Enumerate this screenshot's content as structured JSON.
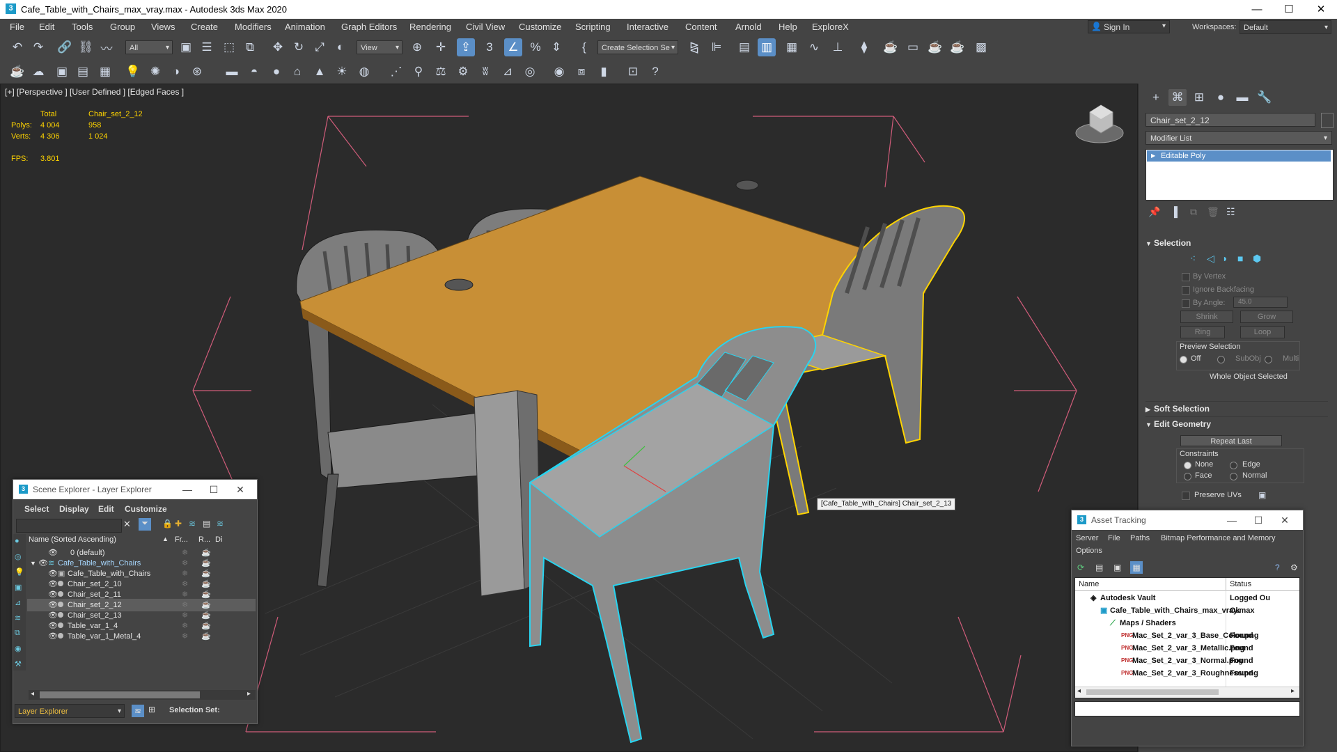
{
  "title_bar": {
    "title": "Cafe_Table_with_Chairs_max_vray.max - Autodesk 3ds Max 2020",
    "minimize": "—",
    "maximize": "☐",
    "close": "✕"
  },
  "menu": [
    "File",
    "Edit",
    "Tools",
    "Group",
    "Views",
    "Create",
    "Modifiers",
    "Animation",
    "Graph Editors",
    "Rendering",
    "Civil View",
    "Customize",
    "Scripting",
    "Interactive",
    "Content",
    "Arnold",
    "Help",
    "ExploreX"
  ],
  "account": {
    "sign_in": "Sign In",
    "workspaces_label": "Workspaces:",
    "workspace_value": "Default"
  },
  "toolbar": {
    "filter_value": "All",
    "ref_coord_value": "View",
    "selection_set_placeholder": "Create Selection Se"
  },
  "viewport": {
    "label": "[+] [Perspective ] [User Defined ] [Edged Faces ]",
    "stats": {
      "total_label": "Total",
      "object_label": "Chair_set_2_12",
      "polys_label": "Polys:",
      "polys_total": "4 004",
      "polys_obj": "958",
      "verts_label": "Verts:",
      "verts_total": "4 306",
      "verts_obj": "1 024",
      "fps_label": "FPS:",
      "fps_value": "3.801"
    },
    "tooltip": "[Cafe_Table_with_Chairs] Chair_set_2_13"
  },
  "command_panel": {
    "object_name": "Chair_set_2_12",
    "object_color": "#444444",
    "modifier_list": "Modifier List",
    "stack_item": "Editable Poly",
    "selection": {
      "title": "Selection",
      "by_vertex": "By Vertex",
      "ignore_backfacing": "Ignore Backfacing",
      "by_angle": "By Angle:",
      "angle_value": "45.0",
      "shrink": "Shrink",
      "grow": "Grow",
      "ring": "Ring",
      "loop": "Loop",
      "preview_selection": "Preview Selection",
      "off": "Off",
      "subobj": "SubObj",
      "multi": "Multi",
      "status": "Whole Object Selected"
    },
    "soft_selection": "Soft Selection",
    "edit_geometry": {
      "title": "Edit Geometry",
      "repeat_last": "Repeat Last",
      "constraints": "Constraints",
      "none": "None",
      "edge": "Edge",
      "face": "Face",
      "normal": "Normal",
      "preserve_uvs": "Preserve UVs"
    }
  },
  "scene_explorer": {
    "title": "Scene Explorer - Layer Explorer",
    "menu": [
      "Select",
      "Display",
      "Edit",
      "Customize"
    ],
    "columns": {
      "name": "Name (Sorted Ascending)",
      "sort_arrow": "▲",
      "freeze": "Fr...",
      "render": "R...",
      "display": "Di"
    },
    "rows": [
      {
        "name": "0 (default)",
        "level": 1,
        "selected": false
      },
      {
        "name": "Cafe_Table_with_Chairs",
        "level": 1,
        "selected": false,
        "layer": true
      },
      {
        "name": "Cafe_Table_with_Chairs",
        "level": 2,
        "selected": false
      },
      {
        "name": "Chair_set_2_10",
        "level": 2,
        "selected": false
      },
      {
        "name": "Chair_set_2_11",
        "level": 2,
        "selected": false
      },
      {
        "name": "Chair_set_2_12",
        "level": 2,
        "selected": true
      },
      {
        "name": "Chair_set_2_13",
        "level": 2,
        "selected": false
      },
      {
        "name": "Table_var_1_4",
        "level": 2,
        "selected": false
      },
      {
        "name": "Table_var_1_Metal_4",
        "level": 2,
        "selected": false
      }
    ],
    "footer": {
      "explorer": "Layer Explorer",
      "selection_set": "Selection Set:"
    }
  },
  "asset_tracking": {
    "title": "Asset Tracking",
    "menu": [
      "Server",
      "File",
      "Paths",
      "Bitmap Performance and Memory",
      "Options"
    ],
    "columns": {
      "name": "Name",
      "status": "Status"
    },
    "rows": [
      {
        "name": "Autodesk Vault",
        "status": "Logged Ou",
        "level": 0
      },
      {
        "name": "Cafe_Table_with_Chairs_max_vray.max",
        "status": "Ok",
        "level": 1
      },
      {
        "name": "Maps / Shaders",
        "status": "",
        "level": 2
      },
      {
        "name": "Mac_Set_2_var_3_Base_Color.png",
        "status": "Found",
        "level": 3
      },
      {
        "name": "Mac_Set_2_var_3_Metallic.png",
        "status": "Found",
        "level": 3
      },
      {
        "name": "Mac_Set_2_var_3_Normal.png",
        "status": "Found",
        "level": 3
      },
      {
        "name": "Mac_Set_2_var_3_Roughness.png",
        "status": "Found",
        "level": 3
      }
    ]
  }
}
